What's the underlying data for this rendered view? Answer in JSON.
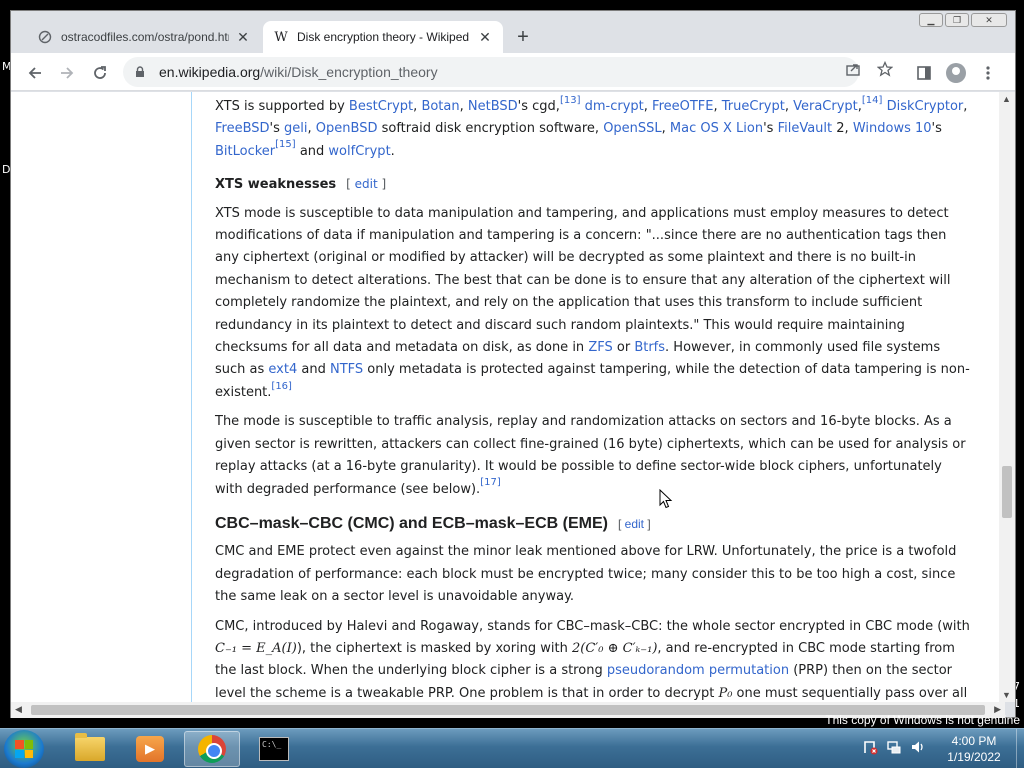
{
  "desktop": {
    "edge_letters": [
      "M",
      "D"
    ],
    "edge_digits": [
      "7",
      "1"
    ],
    "watermark": "This copy of Windows is not genuine"
  },
  "browser": {
    "tabs": [
      {
        "title": "ostracodfiles.com/ostra/pond.htm",
        "active": false,
        "favicon": "globe-icon"
      },
      {
        "title": "Disk encryption theory - Wikiped",
        "active": true,
        "favicon": "wikipedia-icon"
      }
    ],
    "address": {
      "domain": "en.wikipedia.org",
      "path": "/wiki/Disk_encryption_theory"
    }
  },
  "article": {
    "p1": {
      "t1": "XTS is supported by ",
      "l1": "BestCrypt",
      "t2": ", ",
      "l2": "Botan",
      "t3": ", ",
      "l3": "NetBSD",
      "t4": "'s cgd,",
      "r1": "[13]",
      "t5": " ",
      "l4": "dm-crypt",
      "t6": ", ",
      "l5": "FreeOTFE",
      "t7": ", ",
      "l6": "TrueCrypt",
      "t8": ", ",
      "l7": "VeraCrypt",
      "t9": ",",
      "r2": "[14]",
      "t10": " ",
      "l8": "DiskCryptor",
      "t11": ", ",
      "l9": "FreeBSD",
      "t12": "'s ",
      "l10": "geli",
      "t13": ", ",
      "l11": "OpenBSD",
      "t14": " softraid disk encryption software, ",
      "l12": "OpenSSL",
      "t15": ", ",
      "l13": "Mac OS X Lion",
      "t16": "'s ",
      "l14": "FileVault",
      "t17": " 2, ",
      "l15": "Windows 10",
      "t18": "'s ",
      "l16": "BitLocker",
      "r3": "[15]",
      "t19": " and ",
      "l17": "wolfCrypt",
      "t20": "."
    },
    "h3_xts_weak": "XTS weaknesses",
    "edit_label": "edit",
    "p2": {
      "t1": "XTS mode is susceptible to data manipulation and tampering, and applications must employ measures to detect modifications of data if manipulation and tampering is a concern: \"...since there are no authentication tags then any ciphertext (original or modified by attacker) will be decrypted as some plaintext and there is no built-in mechanism to detect alterations. The best that can be done is to ensure that any alteration of the ciphertext will completely randomize the plaintext, and rely on the application that uses this transform to include sufficient redundancy in its plaintext to detect and discard such random plaintexts.\" This would require maintaining checksums for all data and metadata on disk, as done in ",
      "l1": "ZFS",
      "t2": " or ",
      "l2": "Btrfs",
      "t3": ". However, in commonly used file systems such as ",
      "l3": "ext4",
      "t4": " and ",
      "l4": "NTFS",
      "t5": " only metadata is protected against tampering, while the detection of data tampering is non-existent.",
      "r1": "[16]"
    },
    "p3": {
      "t1": "The mode is susceptible to traffic analysis, replay and randomization attacks on sectors and 16-byte blocks. As a given sector is rewritten, attackers can collect fine-grained (16 byte) ciphertexts, which can be used for analysis or replay attacks (at a 16-byte granularity). It would be possible to define sector-wide block ciphers, unfortunately with degraded performance (see below).",
      "r1": "[17]"
    },
    "h2_cmc": "CBC–mask–CBC (CMC) and ECB–mask–ECB (EME)",
    "p4": "CMC and EME protect even against the minor leak mentioned above for LRW. Unfortunately, the price is a twofold degradation of performance: each block must be encrypted twice; many consider this to be too high a cost, since the same leak on a sector level is unavoidable anyway.",
    "p5": {
      "t1": "CMC, introduced by Halevi and Rogaway, stands for CBC–mask–CBC: the whole sector encrypted in CBC mode (with ",
      "m1": "C₋₁ = E_A(I)",
      "t2": "), the ciphertext is masked by xoring with ",
      "m2": "2(C′₀ ⊕ C′ₖ₋₁)",
      "t3": ", and re-encrypted in CBC mode starting from the last block. When the underlying block cipher is a strong ",
      "l1": "pseudorandom permutation",
      "t4": " (PRP) then on the sector level the scheme is a tweakable PRP. One problem is that in order to decrypt ",
      "m3": "P₀",
      "t5": " one must sequentially pass over all the data"
    }
  },
  "taskbar": {
    "items": [
      "explorer-icon",
      "media-player-icon",
      "chrome-icon",
      "cmd-icon"
    ],
    "clock_time": "4:00 PM",
    "clock_date": "1/19/2022"
  }
}
